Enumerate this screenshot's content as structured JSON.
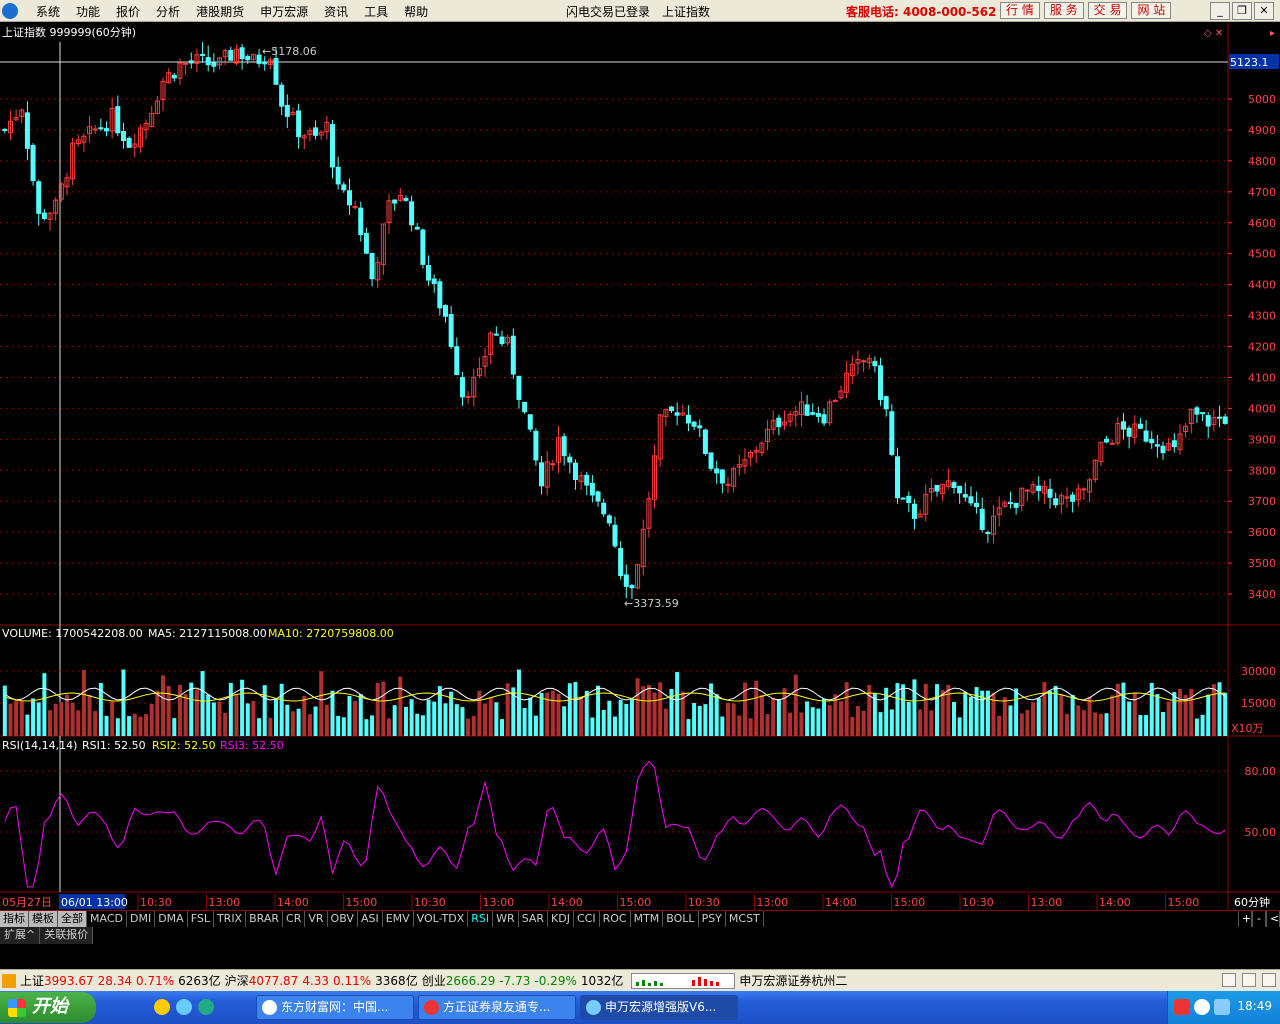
{
  "menubar": {
    "items": [
      "系统",
      "功能",
      "报价",
      "分析",
      "港股期货",
      "申万宏源",
      "资讯",
      "工具",
      "帮助"
    ],
    "status_login": "闪电交易已登录",
    "status_index": "上证指数",
    "hotline": "客服电话: 4008-000-562",
    "top_buttons": [
      "行 情",
      "服 务",
      "交 易",
      "网 站"
    ]
  },
  "main_panel": {
    "header": "上证指数 999999(60分钟)",
    "high_label": "5178.06",
    "low_label": "3373.59",
    "cursor_price": "5123.1",
    "price_ticks": [
      "5000",
      "4900",
      "4800",
      "4700",
      "4600",
      "4500",
      "4400",
      "4300",
      "4200",
      "4100",
      "4000",
      "3900",
      "3800",
      "3700",
      "3600",
      "3500",
      "3400"
    ]
  },
  "volume_panel": {
    "label": "VOLUME: 1700542208.00",
    "ma5": "MA5: 2127115008.00",
    "ma10": "MA10: 2720759808.00",
    "ticks": [
      "30000",
      "15000"
    ],
    "unit": "X10万"
  },
  "rsi_panel": {
    "label": "RSI(14,14,14)",
    "rsi1": "RSI1: 52.50",
    "rsi2": "RSI2: 52.50",
    "rsi3": "RSI3: 52.50",
    "ticks": [
      "80.00",
      "50.00"
    ]
  },
  "time_axis": {
    "date_start": "05月27日",
    "cursor_time": "06/01 13:00",
    "labels": [
      "10:30",
      "13:00",
      "14:00",
      "15:00",
      "10:30",
      "13:00",
      "14:00",
      "15:00",
      "10:30",
      "13:00",
      "14:00",
      "15:00",
      "10:30",
      "13:00",
      "14:00",
      "15:00"
    ],
    "period": "60分钟"
  },
  "indicator_tabs": [
    "指标",
    "模板",
    "全部",
    "MACD",
    "DMI",
    "DMA",
    "FSL",
    "TRIX",
    "BRAR",
    "CR",
    "VR",
    "OBV",
    "ASI",
    "EMV",
    "VOL-TDX",
    "RSI",
    "WR",
    "SAR",
    "KDJ",
    "CCI",
    "ROC",
    "MTM",
    "BOLL",
    "PSY",
    "MCST"
  ],
  "tab_tools": [
    "+",
    "-",
    "<"
  ],
  "sub_tabs": [
    "扩展^",
    "关联报价"
  ],
  "ticker": {
    "sh_name": "上证",
    "sh_price": "3993.67",
    "sh_change": "28.34",
    "sh_pct": "0.71%",
    "sh_amount": "6263亿",
    "hs_name": "沪深",
    "hs_price": "4077.87",
    "hs_change": "4.33",
    "hs_pct": "0.11%",
    "hs_amount": "3368亿",
    "cy_name": "创业",
    "cy_price": "2666.29",
    "cy_change": "-7.73",
    "cy_pct": "-0.29%",
    "cy_amount": "1032亿",
    "broker": "申万宏源证券杭州二"
  },
  "taskbar": {
    "start": "开始",
    "tasks": [
      "东方财富网：中国...",
      "方正证券泉友通专...",
      "申万宏源增强版V6..."
    ],
    "clock": "18:49"
  },
  "colors": {
    "up": "#ff3b3b",
    "down": "#54ffff",
    "rsi": "#ff00ff",
    "ma5": "#ffffff",
    "ma10": "#ffff00",
    "grid": "#8b0000"
  }
}
